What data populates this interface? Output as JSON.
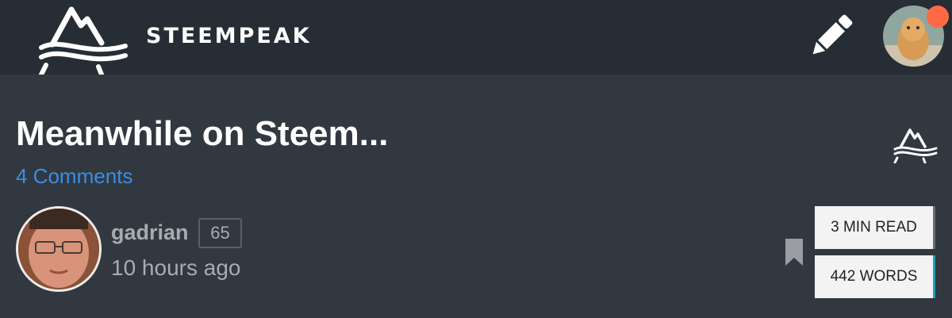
{
  "header": {
    "brand": "STEEMPEAK",
    "logo_icon": "steempeak-mountain-logo-icon",
    "compose_icon": "pencil-icon",
    "notification_color": "#ff6a45"
  },
  "post": {
    "title": "Meanwhile on Steem...",
    "comments": "4 Comments",
    "author": "gadrian",
    "reputation": "65",
    "time": "10 hours ago",
    "read_time": "3 MIN READ",
    "words": "442 WORDS"
  },
  "colors": {
    "header_bg": "#262d34",
    "page_bg": "#323840",
    "link": "#3b8ee2",
    "words_accent": "#1fa1b8"
  }
}
